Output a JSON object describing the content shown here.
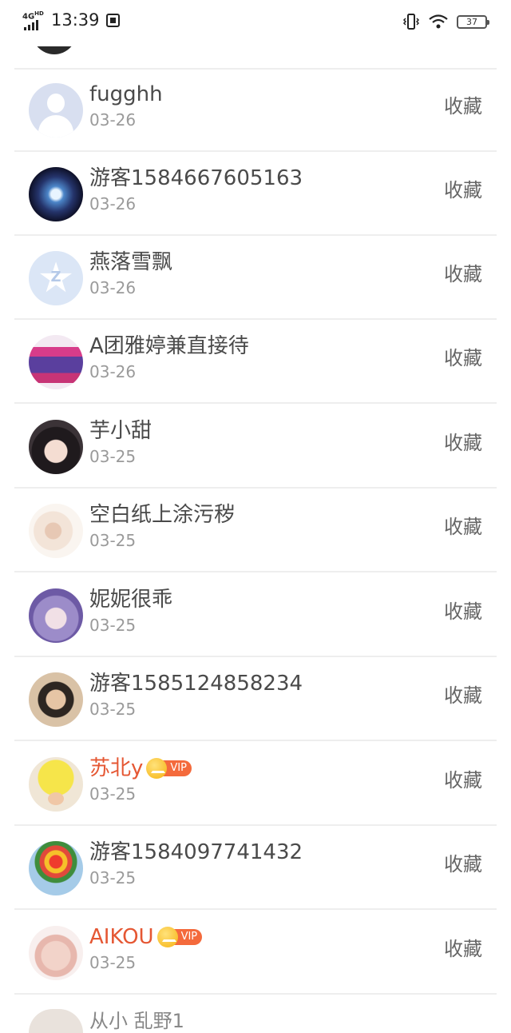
{
  "status_bar": {
    "network": "4G",
    "network_sup": "HD",
    "time": "13:39",
    "battery": "37"
  },
  "favorite_label": "收藏",
  "rows": [
    {
      "name": "fugghh",
      "date": "03-26",
      "vip": false
    },
    {
      "name": "游客1584667605163",
      "date": "03-26",
      "vip": false
    },
    {
      "name": "燕落雪飘",
      "date": "03-26",
      "vip": false
    },
    {
      "name": "A团雅婷兼直接待",
      "date": "03-26",
      "vip": false
    },
    {
      "name": "芋小甜",
      "date": "03-25",
      "vip": false
    },
    {
      "name": "空白纸上涂污秽",
      "date": "03-25",
      "vip": false
    },
    {
      "name": "妮妮很乖",
      "date": "03-25",
      "vip": false
    },
    {
      "name": "游客1585124858234",
      "date": "03-25",
      "vip": false
    },
    {
      "name": "苏北y",
      "date": "03-25",
      "vip": true,
      "badge": "VIP"
    },
    {
      "name": "游客1584097741432",
      "date": "03-25",
      "vip": false
    },
    {
      "name": "AIKOU",
      "date": "03-25",
      "vip": true,
      "badge": "VIP"
    }
  ],
  "partial_bottom_name": "从小 乱野1",
  "colors": {
    "vip_name": "#e55733",
    "vip_tag": "#f46a3c",
    "divider": "#eeeeee"
  }
}
